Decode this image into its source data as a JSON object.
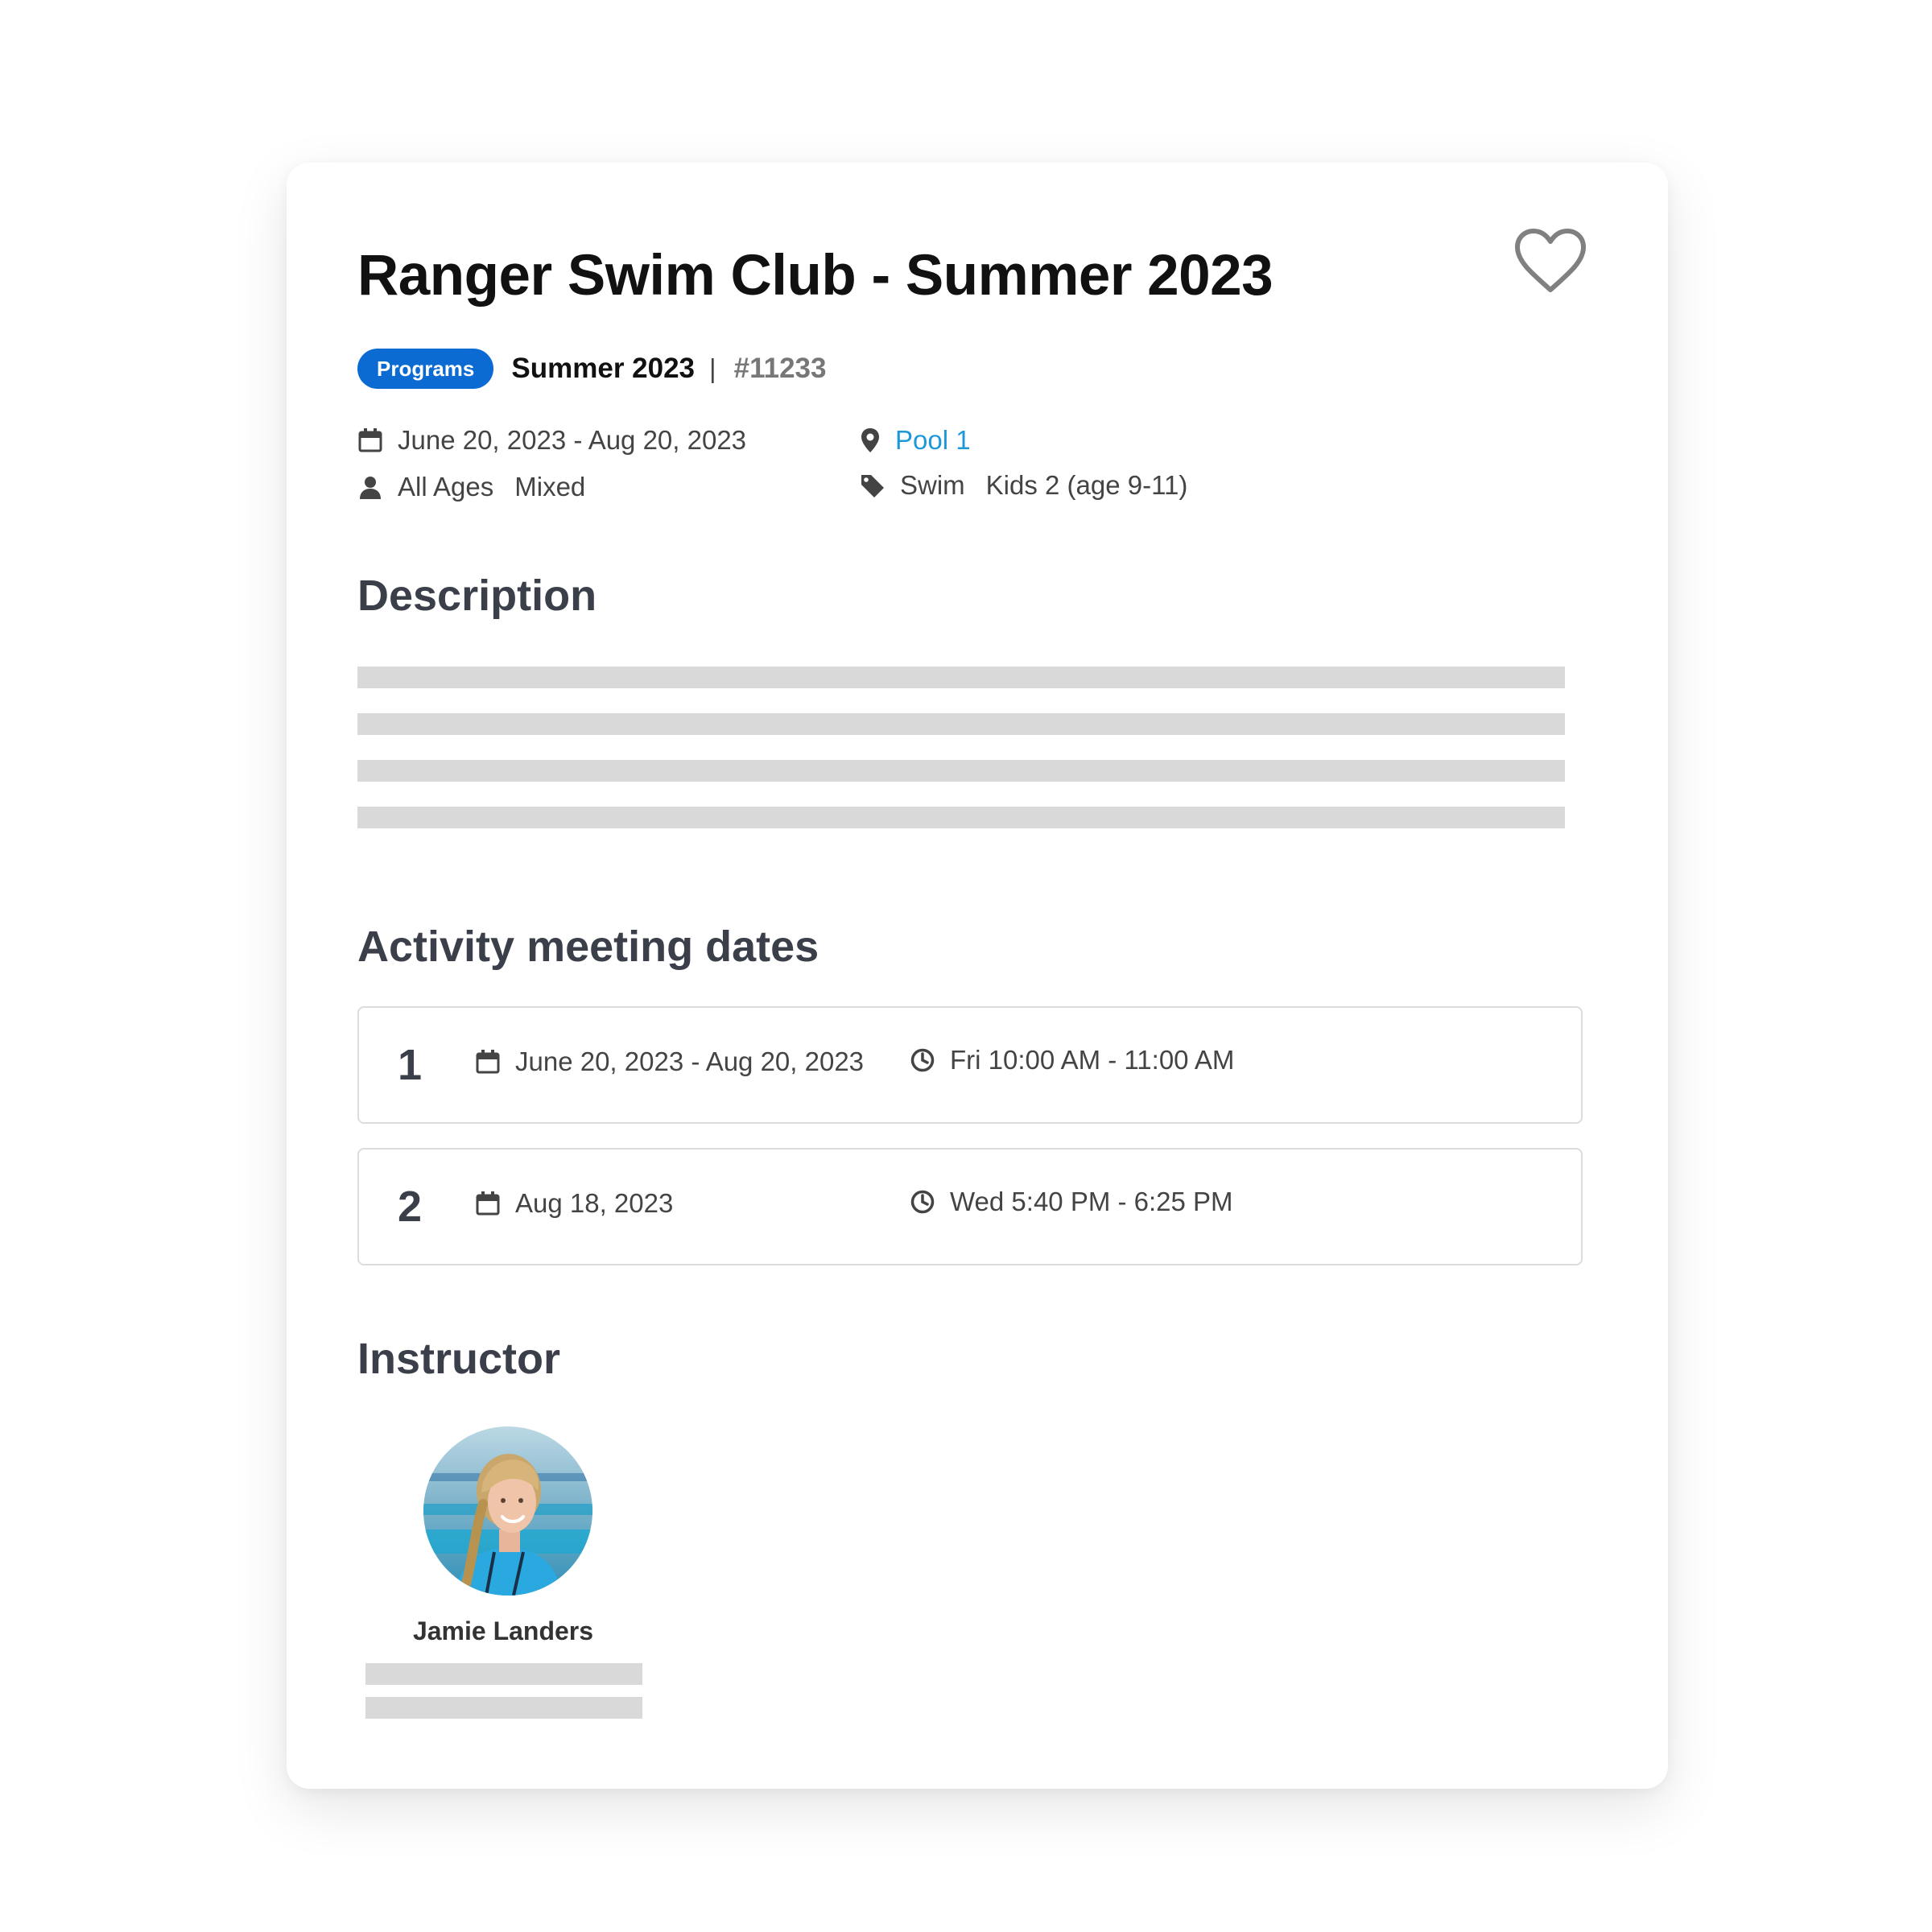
{
  "header": {
    "title": "Ranger Swim Club - Summer 2023",
    "badge": "Programs",
    "season": "Summer 2023",
    "separator": "|",
    "activity_number": "#11233"
  },
  "details": {
    "date_range": "June 20, 2023 - Aug 20, 2023",
    "ages": "All Ages",
    "gender": "Mixed",
    "location": "Pool 1",
    "category": "Swim",
    "level": "Kids 2 (age 9-11)"
  },
  "description": {
    "heading": "Description"
  },
  "meeting_dates": {
    "heading": "Activity meeting dates",
    "rows": [
      {
        "number": "1",
        "dates": "June 20, 2023 - Aug 20, 2023",
        "time": "Fri 10:00 AM - 11:00 AM"
      },
      {
        "number": "2",
        "dates": "Aug 18, 2023",
        "time": "Wed 5:40 PM - 6:25 PM"
      }
    ]
  },
  "instructor": {
    "heading": "Instructor",
    "name": "Jamie Landers"
  },
  "colors": {
    "badge": "#0b6bd3",
    "link": "#1e98d8",
    "heading": "#3a3f4a",
    "placeholder": "#d9d9d9"
  },
  "icons": [
    "heart-icon",
    "calendar-icon",
    "user-icon",
    "map-pin-icon",
    "tag-icon",
    "clock-icon"
  ]
}
